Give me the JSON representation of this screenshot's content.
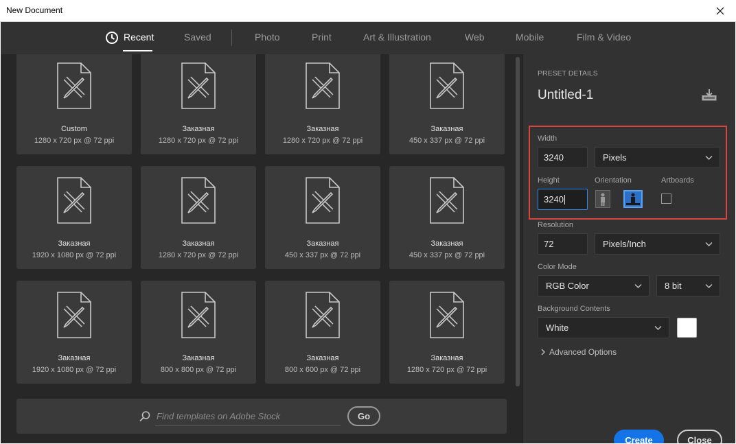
{
  "window": {
    "title": "New Document"
  },
  "tabs": [
    {
      "label": "Recent",
      "active": true
    },
    {
      "label": "Saved",
      "active": false
    },
    {
      "label": "Photo",
      "active": false
    },
    {
      "label": "Print",
      "active": false
    },
    {
      "label": "Art & Illustration",
      "active": false
    },
    {
      "label": "Web",
      "active": false
    },
    {
      "label": "Mobile",
      "active": false
    },
    {
      "label": "Film & Video",
      "active": false
    }
  ],
  "recent": [
    {
      "name": "Custom",
      "size": "1280 x 720 px @ 72 ppi"
    },
    {
      "name": "Заказная",
      "size": "1280 x 720 px @ 72 ppi"
    },
    {
      "name": "Заказная",
      "size": "1280 x 720 px @ 72 ppi"
    },
    {
      "name": "Заказная",
      "size": "450 x 337 px @ 72 ppi"
    },
    {
      "name": "Заказная",
      "size": "1920 x 1080 px @ 72 ppi"
    },
    {
      "name": "Заказная",
      "size": "1280 x 720 px @ 72 ppi"
    },
    {
      "name": "Заказная",
      "size": "450 x 337 px @ 72 ppi"
    },
    {
      "name": "Заказная",
      "size": "450 x 337 px @ 72 ppi"
    },
    {
      "name": "Заказная",
      "size": "1920 x 1080 px @ 72 ppi"
    },
    {
      "name": "Заказная",
      "size": "800 x 800 px @ 72 ppi"
    },
    {
      "name": "Заказная",
      "size": "800 x 600 px @ 72 ppi"
    },
    {
      "name": "Заказная",
      "size": "1280 x 720 px @ 72 ppi"
    }
  ],
  "search": {
    "placeholder": "Find templates on Adobe Stock",
    "go_label": "Go"
  },
  "preset": {
    "header": "PRESET DETAILS",
    "name": "Untitled-1",
    "width_label": "Width",
    "width_value": "3240",
    "width_unit": "Pixels",
    "height_label": "Height",
    "height_value": "3240",
    "orientation_label": "Orientation",
    "orientation_selected": "landscape",
    "artboards_label": "Artboards",
    "artboards_checked": false,
    "resolution_label": "Resolution",
    "resolution_value": "72",
    "resolution_unit": "Pixels/Inch",
    "color_mode_label": "Color Mode",
    "color_mode": "RGB Color",
    "bit_depth": "8 bit",
    "background_label": "Background Contents",
    "background": "White",
    "background_color": "#ffffff",
    "advanced_label": "Advanced Options"
  },
  "buttons": {
    "create": "Create",
    "close": "Close"
  },
  "colors": {
    "accent": "#1473e6",
    "highlight": "#d9443f",
    "focus": "#2d8ceb"
  }
}
